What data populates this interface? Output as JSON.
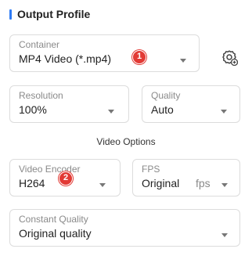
{
  "section": {
    "title": "Output Profile"
  },
  "container": {
    "label": "Container",
    "value": "MP4 Video (*.mp4)",
    "badge": "1"
  },
  "settings": {
    "icon": "gear-add-icon"
  },
  "resolution": {
    "label": "Resolution",
    "value": "100%"
  },
  "quality": {
    "label": "Quality",
    "value": "Auto"
  },
  "video_options": {
    "title": "Video Options"
  },
  "video_encoder": {
    "label": "Video Encoder",
    "value": "H264",
    "badge": "2"
  },
  "fps": {
    "label": "FPS",
    "value": "Original",
    "unit": "fps"
  },
  "constant_quality": {
    "label": "Constant Quality",
    "value": "Original quality"
  },
  "colors": {
    "accent": "#2f7cf6",
    "badge": "#e23a35"
  }
}
